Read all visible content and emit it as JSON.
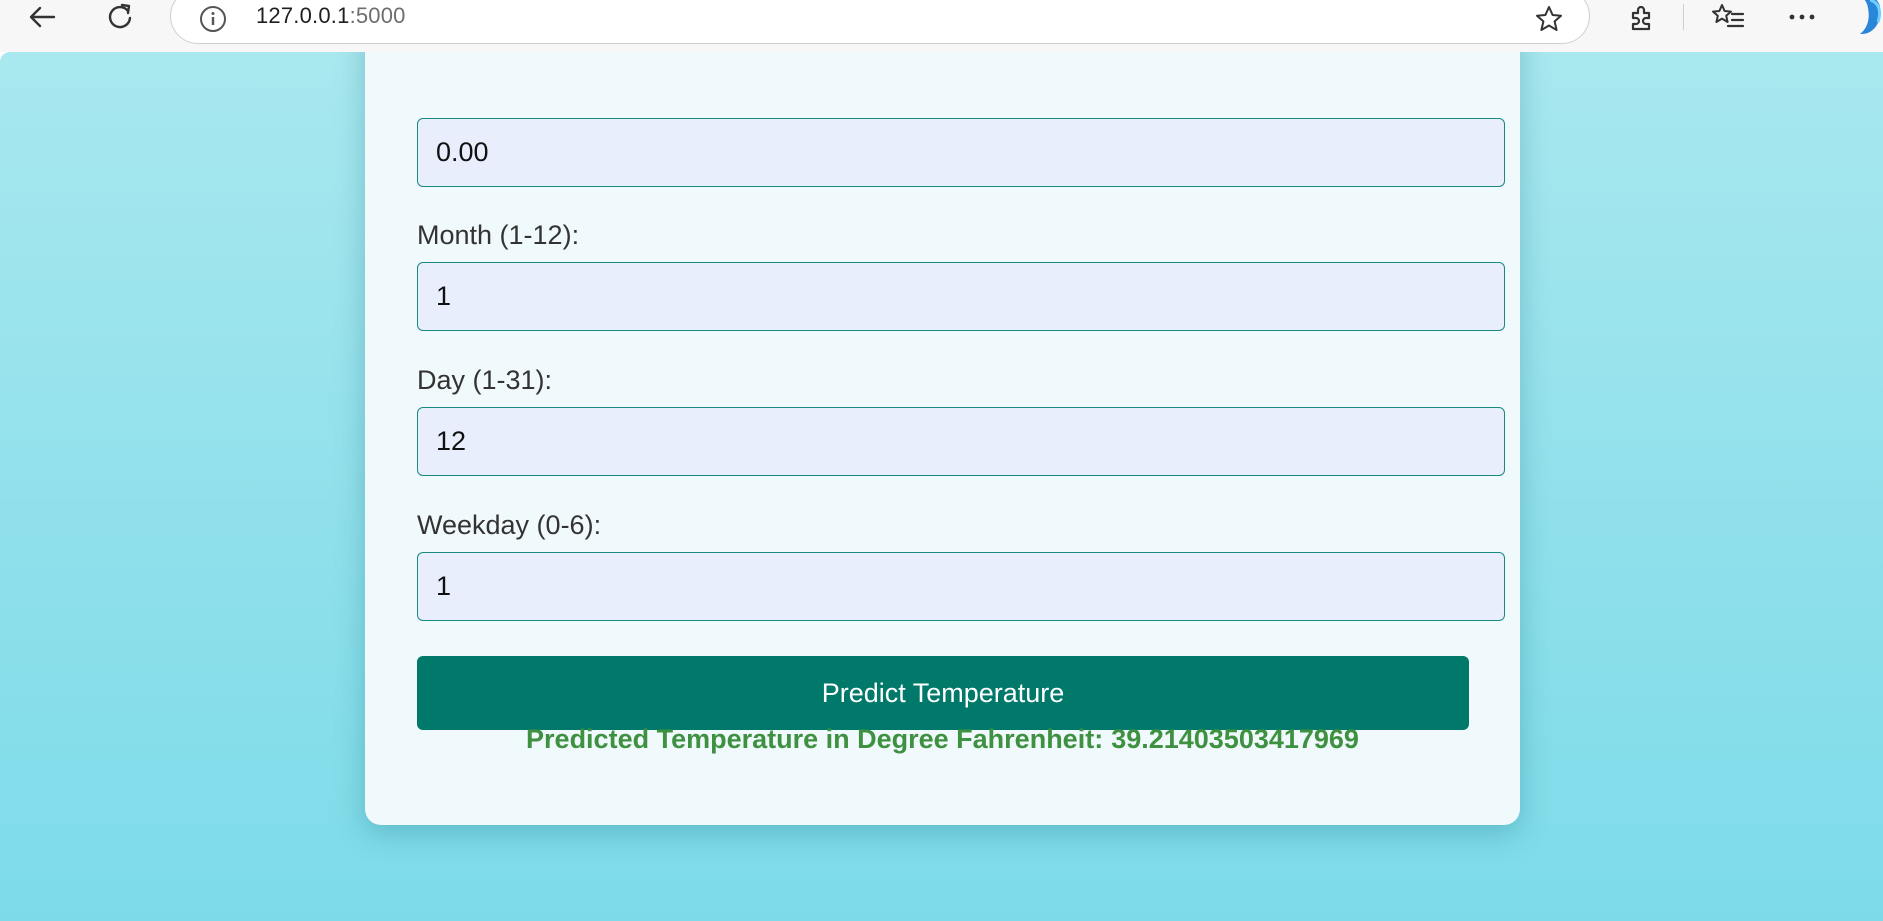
{
  "browser": {
    "url_host": "127.0.0.1",
    "url_port": ":5000"
  },
  "form": {
    "fields": [
      {
        "label": "",
        "value": "0.00"
      },
      {
        "label": "Month (1-12):",
        "value": "1"
      },
      {
        "label": "Day (1-31):",
        "value": "12"
      },
      {
        "label": "Weekday (0-6):",
        "value": "1"
      }
    ],
    "submit_label": "Predict Temperature"
  },
  "result": {
    "label": "Predicted Temperature in Degree Fahrenheit:",
    "value": "39.21403503417969"
  },
  "colors": {
    "button": "#00796b",
    "result_text": "#3d9140",
    "input_bg": "#e8eefc",
    "input_border": "#1a8a80"
  }
}
